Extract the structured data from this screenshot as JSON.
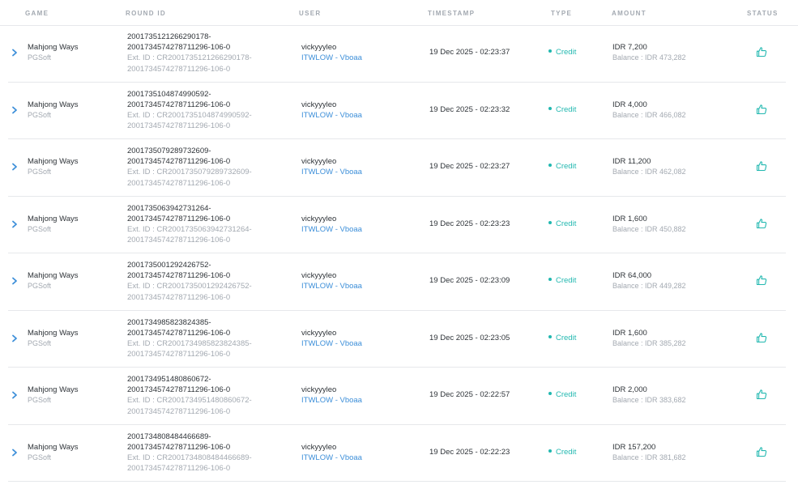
{
  "headers": {
    "game": "GAME",
    "round_id": "ROUND ID",
    "user": "USER",
    "timestamp": "TIMESTAMP",
    "type": "TYPE",
    "amount": "AMOUNT",
    "status": "STATUS"
  },
  "icons": {
    "expand": "chevron-right-icon",
    "status": "thumbs-up-icon"
  },
  "colors": {
    "accent": "#3d8fd9",
    "credit": "#22b8b0",
    "muted": "#a3a9b1"
  },
  "rows": [
    {
      "game": "Mahjong Ways",
      "provider": "PGSoft",
      "round_line1": "2001735121266290178-",
      "round_line2": "2001734574278711296-106-0",
      "ext_line1": "Ext. ID : CR2001735121266290178-",
      "ext_line2": "2001734574278711296-106-0",
      "user": "vickyyyleo",
      "user_link": "ITWLOW - Vboaa",
      "timestamp": "19 Dec 2025 - 02:23:37",
      "type": "Credit",
      "amount": "IDR 7,200",
      "balance": "Balance : IDR 473,282"
    },
    {
      "game": "Mahjong Ways",
      "provider": "PGSoft",
      "round_line1": "2001735104874990592-",
      "round_line2": "2001734574278711296-106-0",
      "ext_line1": "Ext. ID : CR2001735104874990592-",
      "ext_line2": "2001734574278711296-106-0",
      "user": "vickyyyleo",
      "user_link": "ITWLOW - Vboaa",
      "timestamp": "19 Dec 2025 - 02:23:32",
      "type": "Credit",
      "amount": "IDR 4,000",
      "balance": "Balance : IDR 466,082"
    },
    {
      "game": "Mahjong Ways",
      "provider": "PGSoft",
      "round_line1": "2001735079289732609-",
      "round_line2": "2001734574278711296-106-0",
      "ext_line1": "Ext. ID : CR2001735079289732609-",
      "ext_line2": "2001734574278711296-106-0",
      "user": "vickyyyleo",
      "user_link": "ITWLOW - Vboaa",
      "timestamp": "19 Dec 2025 - 02:23:27",
      "type": "Credit",
      "amount": "IDR 11,200",
      "balance": "Balance : IDR 462,082"
    },
    {
      "game": "Mahjong Ways",
      "provider": "PGSoft",
      "round_line1": "2001735063942731264-",
      "round_line2": "2001734574278711296-106-0",
      "ext_line1": "Ext. ID : CR2001735063942731264-",
      "ext_line2": "2001734574278711296-106-0",
      "user": "vickyyyleo",
      "user_link": "ITWLOW - Vboaa",
      "timestamp": "19 Dec 2025 - 02:23:23",
      "type": "Credit",
      "amount": "IDR 1,600",
      "balance": "Balance : IDR 450,882"
    },
    {
      "game": "Mahjong Ways",
      "provider": "PGSoft",
      "round_line1": "2001735001292426752-",
      "round_line2": "2001734574278711296-106-0",
      "ext_line1": "Ext. ID : CR2001735001292426752-",
      "ext_line2": "2001734574278711296-106-0",
      "user": "vickyyyleo",
      "user_link": "ITWLOW - Vboaa",
      "timestamp": "19 Dec 2025 - 02:23:09",
      "type": "Credit",
      "amount": "IDR 64,000",
      "balance": "Balance : IDR 449,282"
    },
    {
      "game": "Mahjong Ways",
      "provider": "PGSoft",
      "round_line1": "2001734985823824385-",
      "round_line2": "2001734574278711296-106-0",
      "ext_line1": "Ext. ID : CR2001734985823824385-",
      "ext_line2": "2001734574278711296-106-0",
      "user": "vickyyyleo",
      "user_link": "ITWLOW - Vboaa",
      "timestamp": "19 Dec 2025 - 02:23:05",
      "type": "Credit",
      "amount": "IDR 1,600",
      "balance": "Balance : IDR 385,282"
    },
    {
      "game": "Mahjong Ways",
      "provider": "PGSoft",
      "round_line1": "2001734951480860672-",
      "round_line2": "2001734574278711296-106-0",
      "ext_line1": "Ext. ID : CR2001734951480860672-",
      "ext_line2": "2001734574278711296-106-0",
      "user": "vickyyyleo",
      "user_link": "ITWLOW - Vboaa",
      "timestamp": "19 Dec 2025 - 02:22:57",
      "type": "Credit",
      "amount": "IDR 2,000",
      "balance": "Balance : IDR 383,682"
    },
    {
      "game": "Mahjong Ways",
      "provider": "PGSoft",
      "round_line1": "2001734808484466689-",
      "round_line2": "2001734574278711296-106-0",
      "ext_line1": "Ext. ID : CR2001734808484466689-",
      "ext_line2": "2001734574278711296-106-0",
      "user": "vickyyyleo",
      "user_link": "ITWLOW - Vboaa",
      "timestamp": "19 Dec 2025 - 02:22:23",
      "type": "Credit",
      "amount": "IDR 157,200",
      "balance": "Balance : IDR 381,682"
    }
  ]
}
